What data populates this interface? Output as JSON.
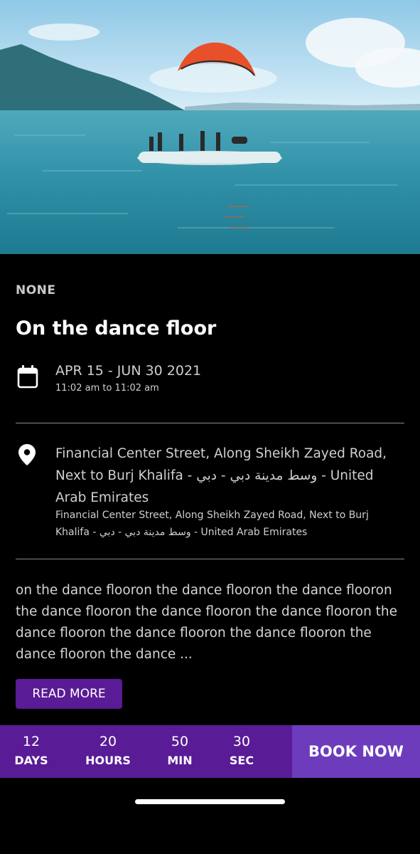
{
  "event": {
    "category": "NONE",
    "title": "On the dance floor",
    "date_range": "APR 15 - JUN 30 2021",
    "time_range": "11:02 am to 11:02 am",
    "address_main": "Financial Center Street, Along Sheikh Zayed Road, Next to Burj Khalifa - وسط مدينة دبي - دبي - United Arab Emirates",
    "address_sub": "Financial Center Street, Along Sheikh Zayed Road, Next to Burj Khalifa - وسط مدينة دبي - دبي - United Arab Emirates",
    "description": "on the dance flooron the dance flooron the dance flooron the dance flooron the dance flooron the dance flooron the dance flooron the dance flooron the dance flooron the dance flooron the dance ..."
  },
  "actions": {
    "read_more_label": "READ MORE",
    "book_now_label": "BOOK NOW"
  },
  "countdown": {
    "days": {
      "value": "12",
      "label": "DAYS"
    },
    "hours": {
      "value": "20",
      "label": "HOURS"
    },
    "min": {
      "value": "50",
      "label": "MIN"
    },
    "sec": {
      "value": "30",
      "label": "SEC"
    }
  },
  "icons": {
    "calendar": "calendar-icon",
    "location": "location-pin-icon"
  },
  "colors": {
    "background": "#000000",
    "accent_purple": "#5a1b96",
    "book_now_purple": "#6c3cbd",
    "text_secondary": "#cfcfcf"
  }
}
